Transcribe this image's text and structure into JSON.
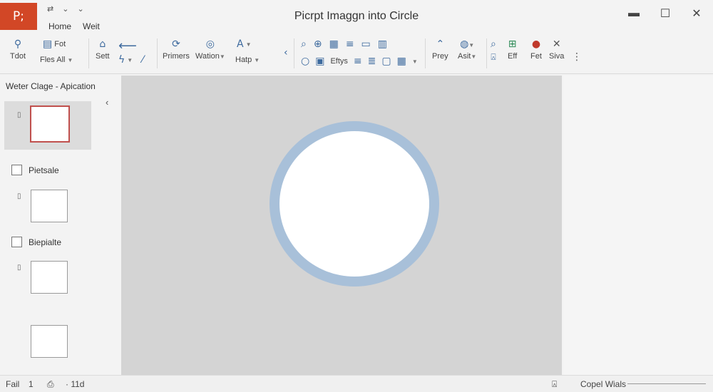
{
  "app": {
    "logo": "P;",
    "title": "Picrpt Imaggn into Circle"
  },
  "qat": [
    "⇄",
    "⌄",
    "⌄"
  ],
  "menu_tabs": [
    "Home",
    "Weit"
  ],
  "window_controls": {
    "minimize": "▬",
    "maximize": "☐",
    "close": "✕"
  },
  "ribbon": {
    "g1": {
      "b1": "Tdot",
      "b2_top": "Fot",
      "b2": "Fles All"
    },
    "g2": {
      "b1": "Sett",
      "b2": "⟵"
    },
    "g3": {
      "b1": "Primers",
      "b2": "Wation",
      "b3": "Hatp"
    },
    "g4": {
      "b1": "Eftys"
    },
    "g5": {
      "b1": "Prey",
      "b2": "Asit"
    },
    "g6": {
      "b1": "Eff",
      "b2": "Fet",
      "b3": "Siva"
    }
  },
  "pane": {
    "title": "Weter Clage - Apication",
    "items": [
      {
        "label": "Pietsale"
      },
      {
        "label": "Biepialte"
      }
    ]
  },
  "status": {
    "left": "Fail",
    "count": "1",
    "note": "· 11d",
    "zoom_label": "Copel Wials"
  },
  "colors": {
    "brand": "#d24726",
    "ring": "#a8c0d9",
    "active_thumb": "#c0504d"
  }
}
